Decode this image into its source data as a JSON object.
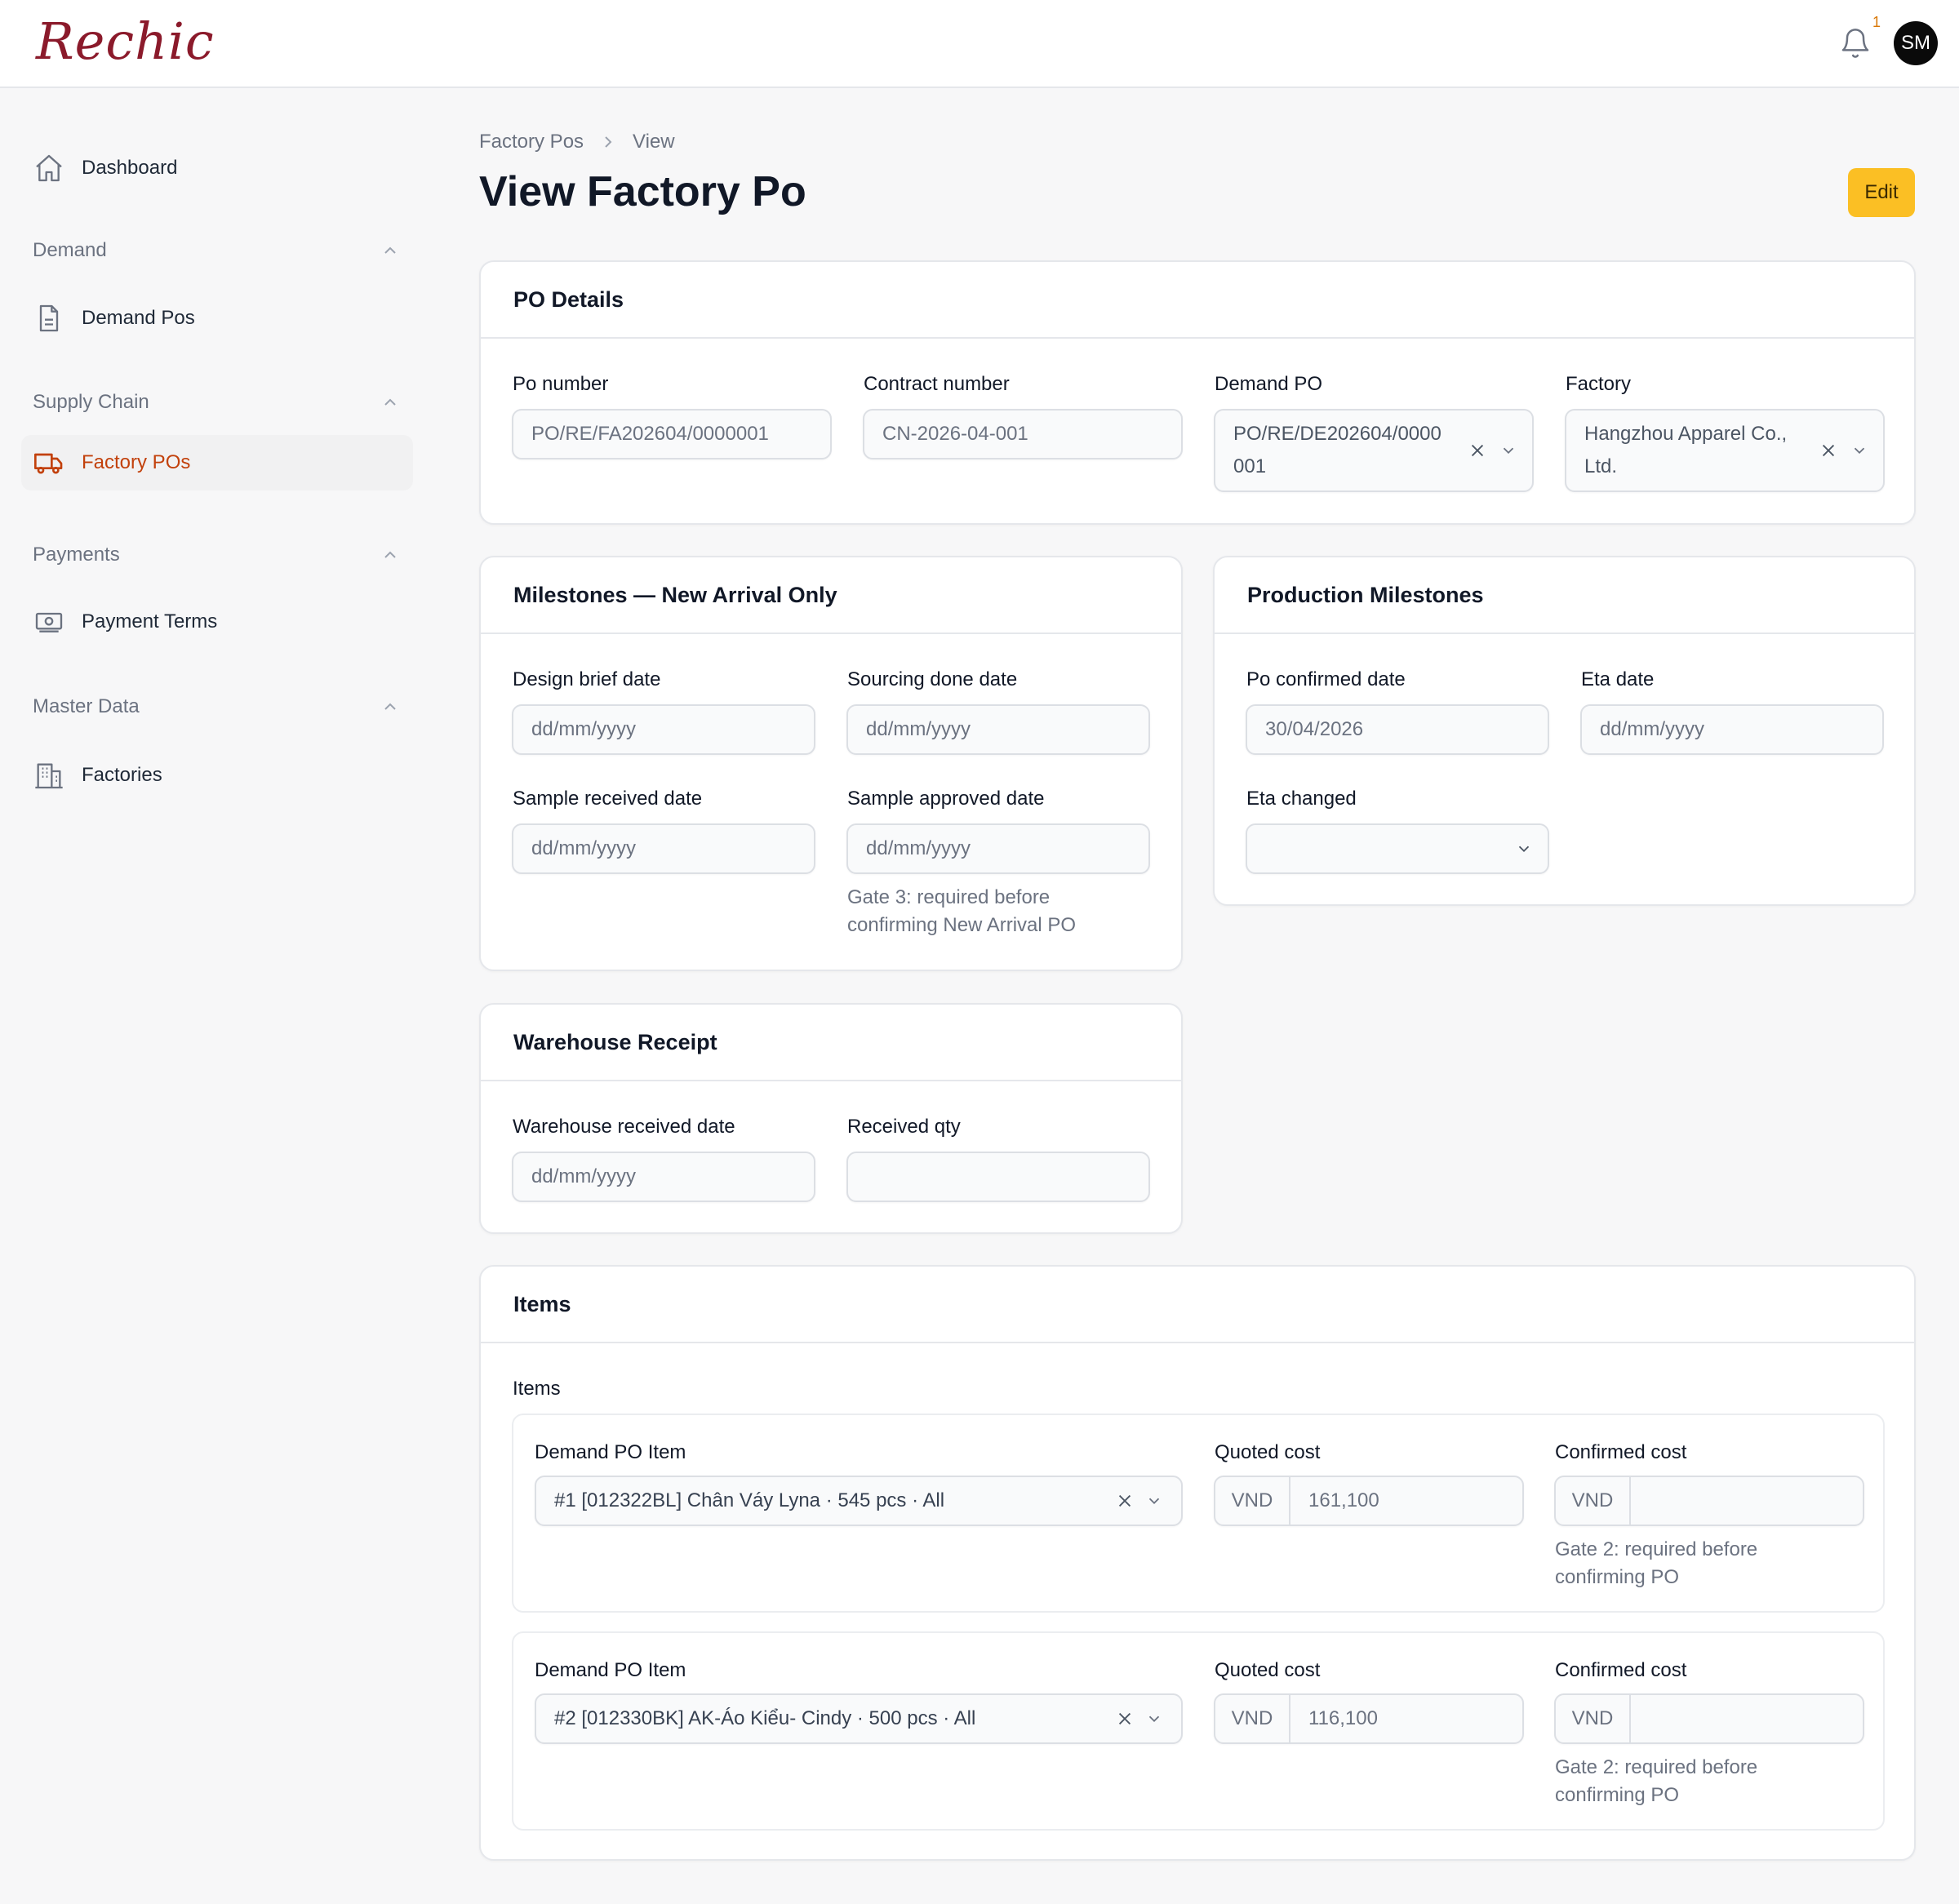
{
  "app": {
    "brand": "Rechic",
    "notification_count": "1",
    "user_initials": "SM"
  },
  "sidebar": {
    "dashboard": "Dashboard",
    "groups": [
      {
        "label": "Demand",
        "items": [
          "Demand Pos"
        ]
      },
      {
        "label": "Supply Chain",
        "items": [
          "Factory POs"
        ]
      },
      {
        "label": "Payments",
        "items": [
          "Payment Terms"
        ]
      },
      {
        "label": "Master Data",
        "items": [
          "Factories"
        ]
      }
    ],
    "active_item": "Factory POs",
    "accent_color": "#c2410c"
  },
  "breadcrumb": {
    "parent": "Factory Pos",
    "current": "View"
  },
  "page": {
    "title": "View Factory Po",
    "edit_label": "Edit",
    "edit_color": "#fbbf24"
  },
  "po_details": {
    "title": "PO Details",
    "po_number": {
      "label": "Po number",
      "value": "PO/RE/FA202604/0000001"
    },
    "contract_number": {
      "label": "Contract number",
      "value": "CN-2026-04-001"
    },
    "demand_po": {
      "label": "Demand PO",
      "value_line1": "PO/RE/DE202604/0000",
      "value_line2": "001"
    },
    "factory": {
      "label": "Factory",
      "value_line1": "Hangzhou Apparel Co.,",
      "value_line2": "Ltd."
    }
  },
  "milestones_new_arrival": {
    "title": "Milestones — New Arrival Only",
    "design_brief": {
      "label": "Design brief date",
      "placeholder": "dd/mm/yyyy"
    },
    "sourcing_done": {
      "label": "Sourcing done date",
      "placeholder": "dd/mm/yyyy"
    },
    "sample_received": {
      "label": "Sample received date",
      "placeholder": "dd/mm/yyyy"
    },
    "sample_approved": {
      "label": "Sample approved date",
      "placeholder": "dd/mm/yyyy",
      "hint_line1": "Gate 3: required before",
      "hint_line2": "confirming New Arrival PO"
    }
  },
  "production_milestones": {
    "title": "Production Milestones",
    "po_confirmed": {
      "label": "Po confirmed date",
      "value": "30/04/2026"
    },
    "eta": {
      "label": "Eta date",
      "placeholder": "dd/mm/yyyy"
    },
    "eta_changed": {
      "label": "Eta changed",
      "value": ""
    }
  },
  "warehouse_receipt": {
    "title": "Warehouse Receipt",
    "received_date": {
      "label": "Warehouse received date",
      "placeholder": "dd/mm/yyyy"
    },
    "received_qty": {
      "label": "Received qty",
      "value": ""
    }
  },
  "items": {
    "title": "Items",
    "list_label": "Items",
    "rows": [
      {
        "demand_item_label": "Demand PO Item",
        "demand_item_value": "#1 [012322BL] Chân Váy Lyna · 545 pcs · All",
        "quoted_label": "Quoted cost",
        "quoted_currency": "VND",
        "quoted_value": "161,100",
        "confirmed_label": "Confirmed cost",
        "confirmed_currency": "VND",
        "confirmed_value": "",
        "hint_line1": "Gate 2: required before",
        "hint_line2": "confirming PO"
      },
      {
        "demand_item_label": "Demand PO Item",
        "demand_item_value": "#2 [012330BK] AK-Áo Kiểu- Cindy · 500 pcs · All",
        "quoted_label": "Quoted cost",
        "quoted_currency": "VND",
        "quoted_value": "116,100",
        "confirmed_label": "Confirmed cost",
        "confirmed_currency": "VND",
        "confirmed_value": "",
        "hint_line1": "Gate 2: required before",
        "hint_line2": "confirming PO"
      }
    ]
  }
}
